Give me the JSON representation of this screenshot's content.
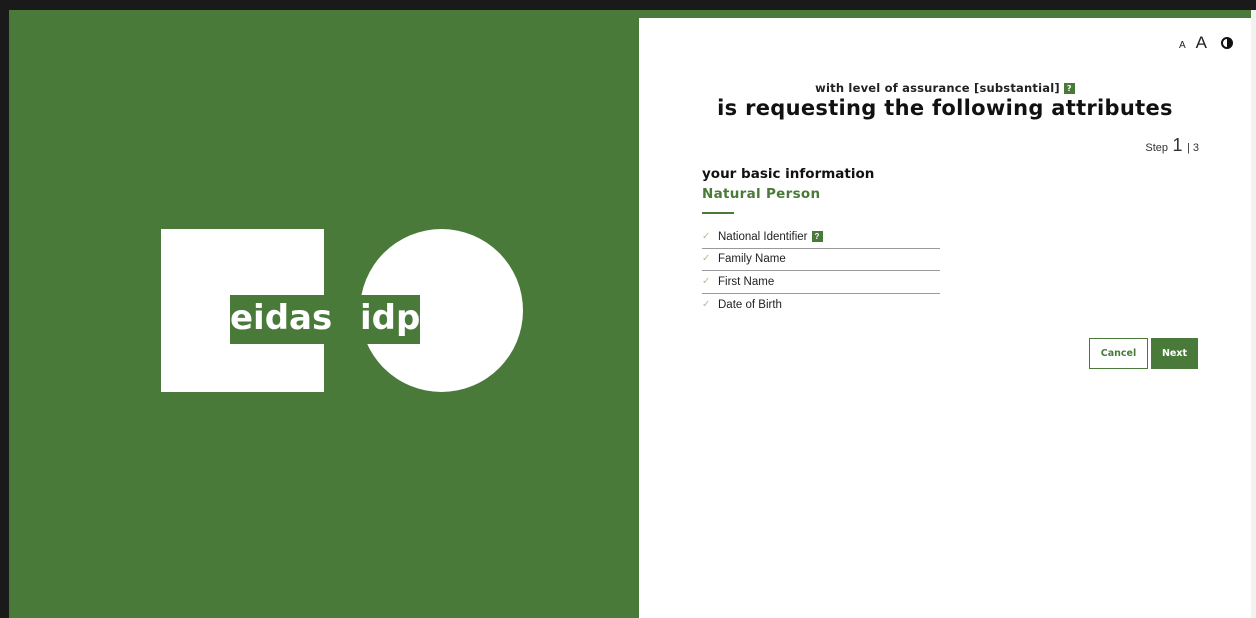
{
  "branding": {
    "logo_left_text": "eidas",
    "logo_right_text": "idp"
  },
  "accessibility": {
    "font_small_label": "A",
    "font_large_label": "A",
    "contrast_icon": "contrast-icon"
  },
  "header": {
    "assurance_text": "with level of assurance [substantial]",
    "help_badge_label": "?",
    "heading": "is requesting the following attributes"
  },
  "step": {
    "word": "Step",
    "current": "1",
    "separator_total": "| 3"
  },
  "section": {
    "title": "your basic information",
    "subtitle": "Natural Person"
  },
  "attributes": [
    {
      "label": "National Identifier",
      "has_help": true,
      "help_label": "?"
    },
    {
      "label": "Family Name"
    },
    {
      "label": "First Name"
    },
    {
      "label": "Date of Birth"
    }
  ],
  "actions": {
    "cancel_label": "Cancel",
    "next_label": "Next"
  },
  "colors": {
    "brand_green": "#4a7a3a",
    "check_green": "#a8c39a"
  }
}
